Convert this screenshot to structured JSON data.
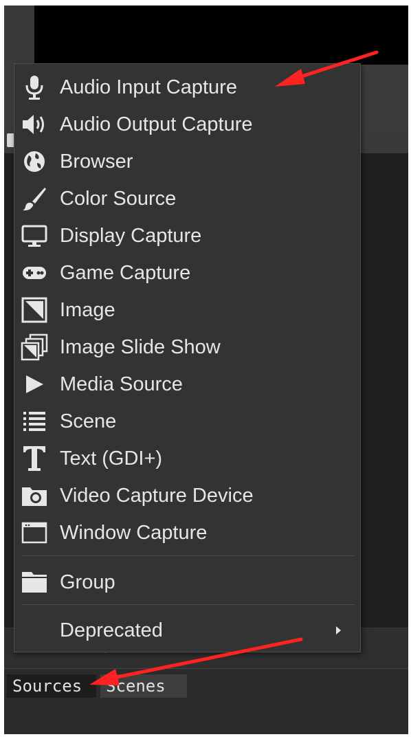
{
  "menu": {
    "items": [
      {
        "label": "Audio Input Capture",
        "icon": "microphone-icon"
      },
      {
        "label": "Audio Output Capture",
        "icon": "speaker-icon"
      },
      {
        "label": "Browser",
        "icon": "globe-icon"
      },
      {
        "label": "Color Source",
        "icon": "paintbrush-icon"
      },
      {
        "label": "Display Capture",
        "icon": "monitor-icon"
      },
      {
        "label": "Game Capture",
        "icon": "gamepad-icon"
      },
      {
        "label": "Image",
        "icon": "image-icon"
      },
      {
        "label": "Image Slide Show",
        "icon": "image-stack-icon"
      },
      {
        "label": "Media Source",
        "icon": "play-icon"
      },
      {
        "label": "Scene",
        "icon": "list-icon"
      },
      {
        "label": "Text (GDI+)",
        "icon": "text-icon"
      },
      {
        "label": "Video Capture Device",
        "icon": "camera-icon"
      },
      {
        "label": "Window Capture",
        "icon": "window-icon"
      }
    ],
    "group": {
      "label": "Group",
      "icon": "folder-icon"
    },
    "deprecated": {
      "label": "Deprecated",
      "icon": "submenu-arrow-icon"
    }
  },
  "dock": {
    "tabs": [
      {
        "label": "Sources"
      },
      {
        "label": "Scenes"
      }
    ]
  },
  "annotations": {
    "arrow_color": "#ff2222"
  },
  "colors": {
    "menu_bg": "#333333",
    "menu_text": "#e6e6e6",
    "app_bg": "#2b2b2b"
  }
}
